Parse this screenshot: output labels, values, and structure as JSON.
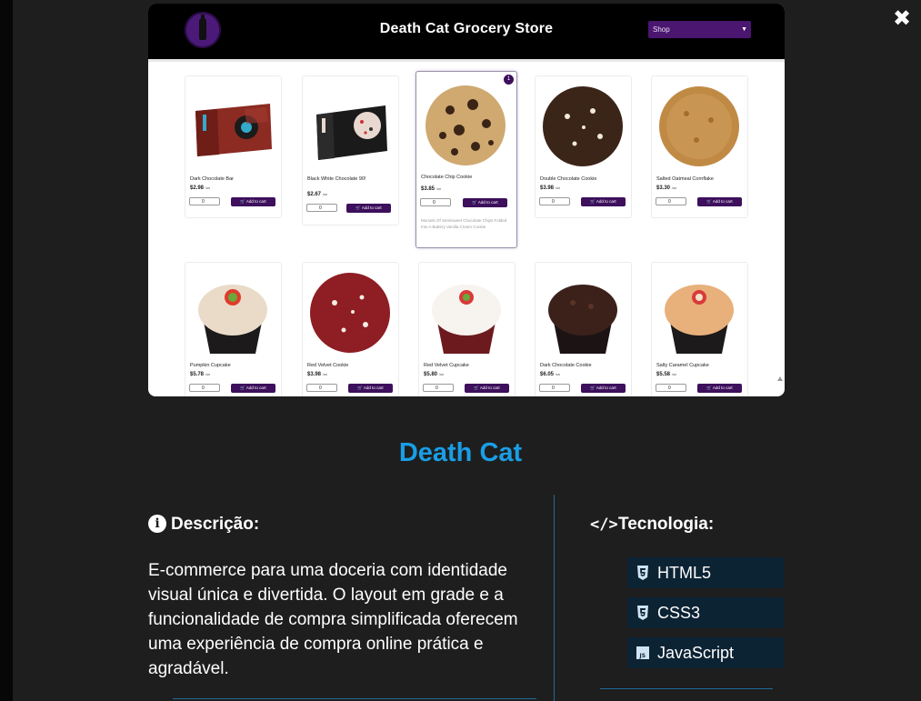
{
  "window": {
    "close_icon": "close-icon"
  },
  "screenshot": {
    "store_title": "Death Cat Grocery Store",
    "shop_select": "Shop",
    "logo_icon": "death-cat-logo",
    "products": [
      {
        "name": "Dark Chocolate Bar",
        "price": "$2.98",
        "unit": "/un",
        "qty": "0",
        "add_label": "Add to cart",
        "image": "dark-chocolate-bar"
      },
      {
        "name": "Black White Chocolate 90!",
        "price": "$2.67",
        "unit": "/un",
        "qty": "0",
        "add_label": "Add to cart",
        "image": "black-white-chocolate"
      },
      {
        "name": "Chocolate Chip Cookie",
        "price": "$3.85",
        "unit": "/un",
        "qty": "0",
        "add_label": "Add to cart",
        "image": "chocolate-chip-cookie",
        "badge": "1",
        "description": "Morsels Of Semisweet Chocolate Chips Folded Into A Buttery Vanilla Cream Cookie"
      },
      {
        "name": "Double Chocolate Cookie",
        "price": "$3.98",
        "unit": "/un",
        "qty": "0",
        "add_label": "Add to cart",
        "image": "double-chocolate-cookie"
      },
      {
        "name": "Salted Oatmeal Cornflake",
        "price": "$3.30",
        "unit": "/un",
        "qty": "0",
        "add_label": "Add to cart",
        "image": "salted-oatmeal-cookie"
      },
      {
        "name": "Pumpkin Cupcake",
        "price": "$5.78",
        "unit": "/un",
        "qty": "0",
        "add_label": "Add to cart",
        "image": "pumpkin-cupcake"
      },
      {
        "name": "Red Velvet Cookie",
        "price": "$3.98",
        "unit": "/un",
        "qty": "0",
        "add_label": "Add to cart",
        "image": "red-velvet-cookie"
      },
      {
        "name": "Red Velvet Cupcake",
        "price": "$5.80",
        "unit": "/un",
        "qty": "0",
        "add_label": "Add to cart",
        "image": "red-velvet-cupcake"
      },
      {
        "name": "Dark Chocolate Cookie",
        "price": "$6.05",
        "unit": "/un",
        "qty": "0",
        "add_label": "Add to cart",
        "image": "dark-chocolate-cupcake"
      },
      {
        "name": "Salty Caramel Cupcake",
        "price": "$5.58",
        "unit": "/un",
        "qty": "0",
        "add_label": "Add to cart",
        "image": "salty-caramel-cupcake"
      }
    ]
  },
  "project": {
    "title": "Death Cat",
    "description_heading": "Descrição:",
    "description": "E-commerce para uma doceria com identidade visual única e divertida. O layout em grade e a funcionalidade de compra simplificada oferecem uma experiência de compra online prática e agradável.",
    "tech_heading": "Tecnologia:",
    "technologies": [
      {
        "label": "HTML5",
        "icon": "html5-icon"
      },
      {
        "label": "CSS3",
        "icon": "css3-icon"
      },
      {
        "label": "JavaScript",
        "icon": "javascript-icon"
      }
    ]
  },
  "colors": {
    "background": "#1e1e1e",
    "accent": "#1a9ee6",
    "store_purple": "#3d0f5c",
    "tech_bg": "#0c2334"
  }
}
